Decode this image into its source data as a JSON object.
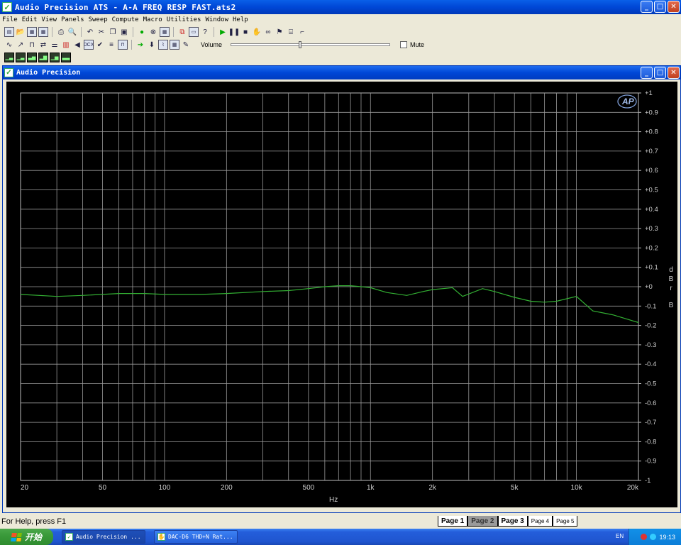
{
  "window": {
    "title": "Audio Precision ATS - A-A FREQ RESP FAST.ats2",
    "buttons": {
      "minimize": "_",
      "maximize": "□",
      "close": "✕"
    }
  },
  "menu": [
    "File",
    "Edit",
    "View",
    "Panels",
    "Sweep",
    "Compute",
    "Macro",
    "Utilities",
    "Window",
    "Help"
  ],
  "toolbar": {
    "volume_label": "Volume",
    "volume_level": 0.43,
    "mute_label": "Mute"
  },
  "child_window": {
    "title": "Audio Precision"
  },
  "chart_data": {
    "type": "line",
    "x_scale": "log",
    "xlim": [
      20,
      20000
    ],
    "ylim": [
      -1,
      1
    ],
    "xlabel": "Hz",
    "ylabel": "d B r B",
    "x_ticks": [
      20,
      50,
      100,
      200,
      500,
      1000,
      2000,
      5000,
      10000,
      20000
    ],
    "x_tick_labels": [
      "20",
      "50",
      "100",
      "200",
      "500",
      "1k",
      "2k",
      "5k",
      "10k",
      "20k"
    ],
    "y_tick_labels": [
      "+1",
      "+0.9",
      "+0.8",
      "+0.7",
      "+0.6",
      "+0.5",
      "+0.4",
      "+0.3",
      "+0.2",
      "+0.1",
      "+0",
      "-0.1",
      "-0.2",
      "-0.3",
      "-0.4",
      "-0.5",
      "-0.6",
      "-0.7",
      "-0.8",
      "-0.9",
      "-1"
    ],
    "grid": true,
    "logo": "AP",
    "series": [
      {
        "color": "#33b033",
        "x": [
          20,
          30,
          40,
          60,
          80,
          100,
          150,
          200,
          300,
          400,
          500,
          600,
          700,
          800,
          900,
          1000,
          1200,
          1500,
          1800,
          2000,
          2500,
          2800,
          3500,
          4000,
          5000,
          6000,
          7000,
          8000,
          10000,
          12000,
          15000,
          20000
        ],
        "y": [
          -0.04,
          -0.05,
          -0.045,
          -0.035,
          -0.035,
          -0.04,
          -0.04,
          -0.035,
          -0.025,
          -0.02,
          -0.01,
          0.0,
          0.005,
          0.005,
          0.0,
          -0.005,
          -0.03,
          -0.045,
          -0.025,
          -0.015,
          -0.005,
          -0.05,
          -0.01,
          -0.025,
          -0.055,
          -0.075,
          -0.08,
          -0.075,
          -0.05,
          -0.125,
          -0.145,
          -0.185
        ]
      }
    ]
  },
  "status": {
    "text": "For Help, press F1"
  },
  "page_tabs": [
    {
      "label": "Page 1",
      "active": false,
      "small": false
    },
    {
      "label": "Page 2",
      "active": true,
      "small": false
    },
    {
      "label": "Page 3",
      "active": false,
      "small": false
    },
    {
      "label": "Page 4",
      "active": false,
      "small": true
    },
    {
      "label": "Page 5",
      "active": false,
      "small": true
    }
  ],
  "taskbar": {
    "start_label": "开始",
    "tasks": [
      {
        "label": "Audio Precision ...",
        "active": true
      },
      {
        "label": "DAC-D6 THD+N Rat...",
        "active": false
      }
    ],
    "language": "EN",
    "clock": "19:13"
  }
}
